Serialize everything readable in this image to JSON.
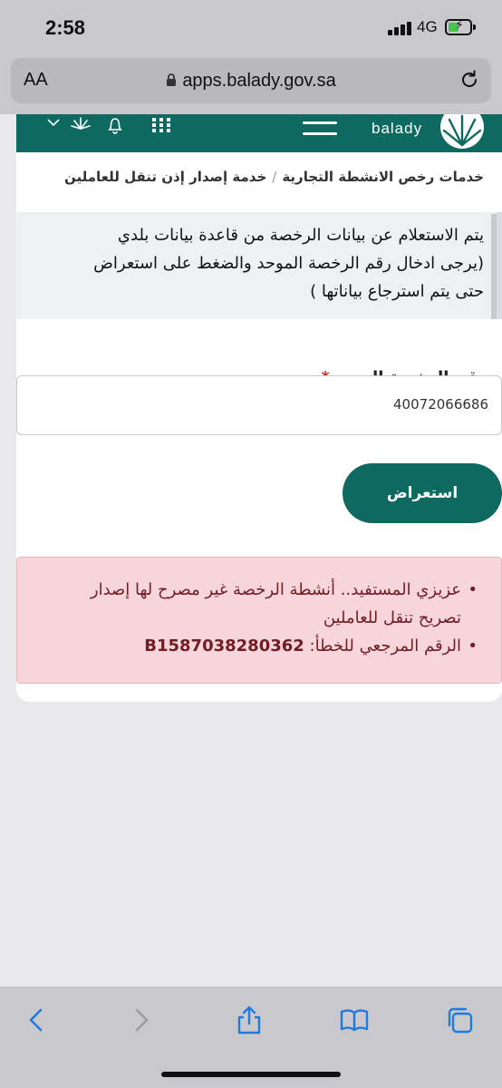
{
  "status_bar": {
    "time": "2:58",
    "network": "4G"
  },
  "browser": {
    "aa_label": "AA",
    "url": "apps.balady.gov.sa"
  },
  "header": {
    "logo_text": "balady"
  },
  "breadcrumb": {
    "items": [
      "خدمات رخص الانشطة التجارية",
      "خدمة إصدار إذن تنقل للعاملين"
    ],
    "separator": "/"
  },
  "info": {
    "lines": [
      "يتم الاستعلام عن بيانات الرخصة من قاعدة بيانات بلدي",
      "(يرجى ادخال رقم الرخصة الموحد والضغط على استعراض",
      "حتى يتم استرجاع بياناتها )"
    ]
  },
  "form": {
    "label": "رقم الرخصة الموحد",
    "required_mark": "*",
    "value": "40072066686",
    "submit_label": "استعراض"
  },
  "alert": {
    "message": "عزيزي المستفيد.. أنشطة الرخصة غير مصرح لها إصدار تصريح تنقل للعاملين",
    "ref_label": "الرقم المرجعي للخطأ:",
    "ref_code": "B1587038280362"
  },
  "colors": {
    "brand": "#0e6a60",
    "alert_bg": "#f6d6da",
    "alert_text": "#721c24",
    "required": "#d32f2f",
    "ios_blue": "#1f7ae0"
  },
  "toolbar": {
    "icons": [
      "back-icon",
      "forward-icon",
      "share-icon",
      "bookmarks-icon",
      "tabs-icon"
    ]
  }
}
